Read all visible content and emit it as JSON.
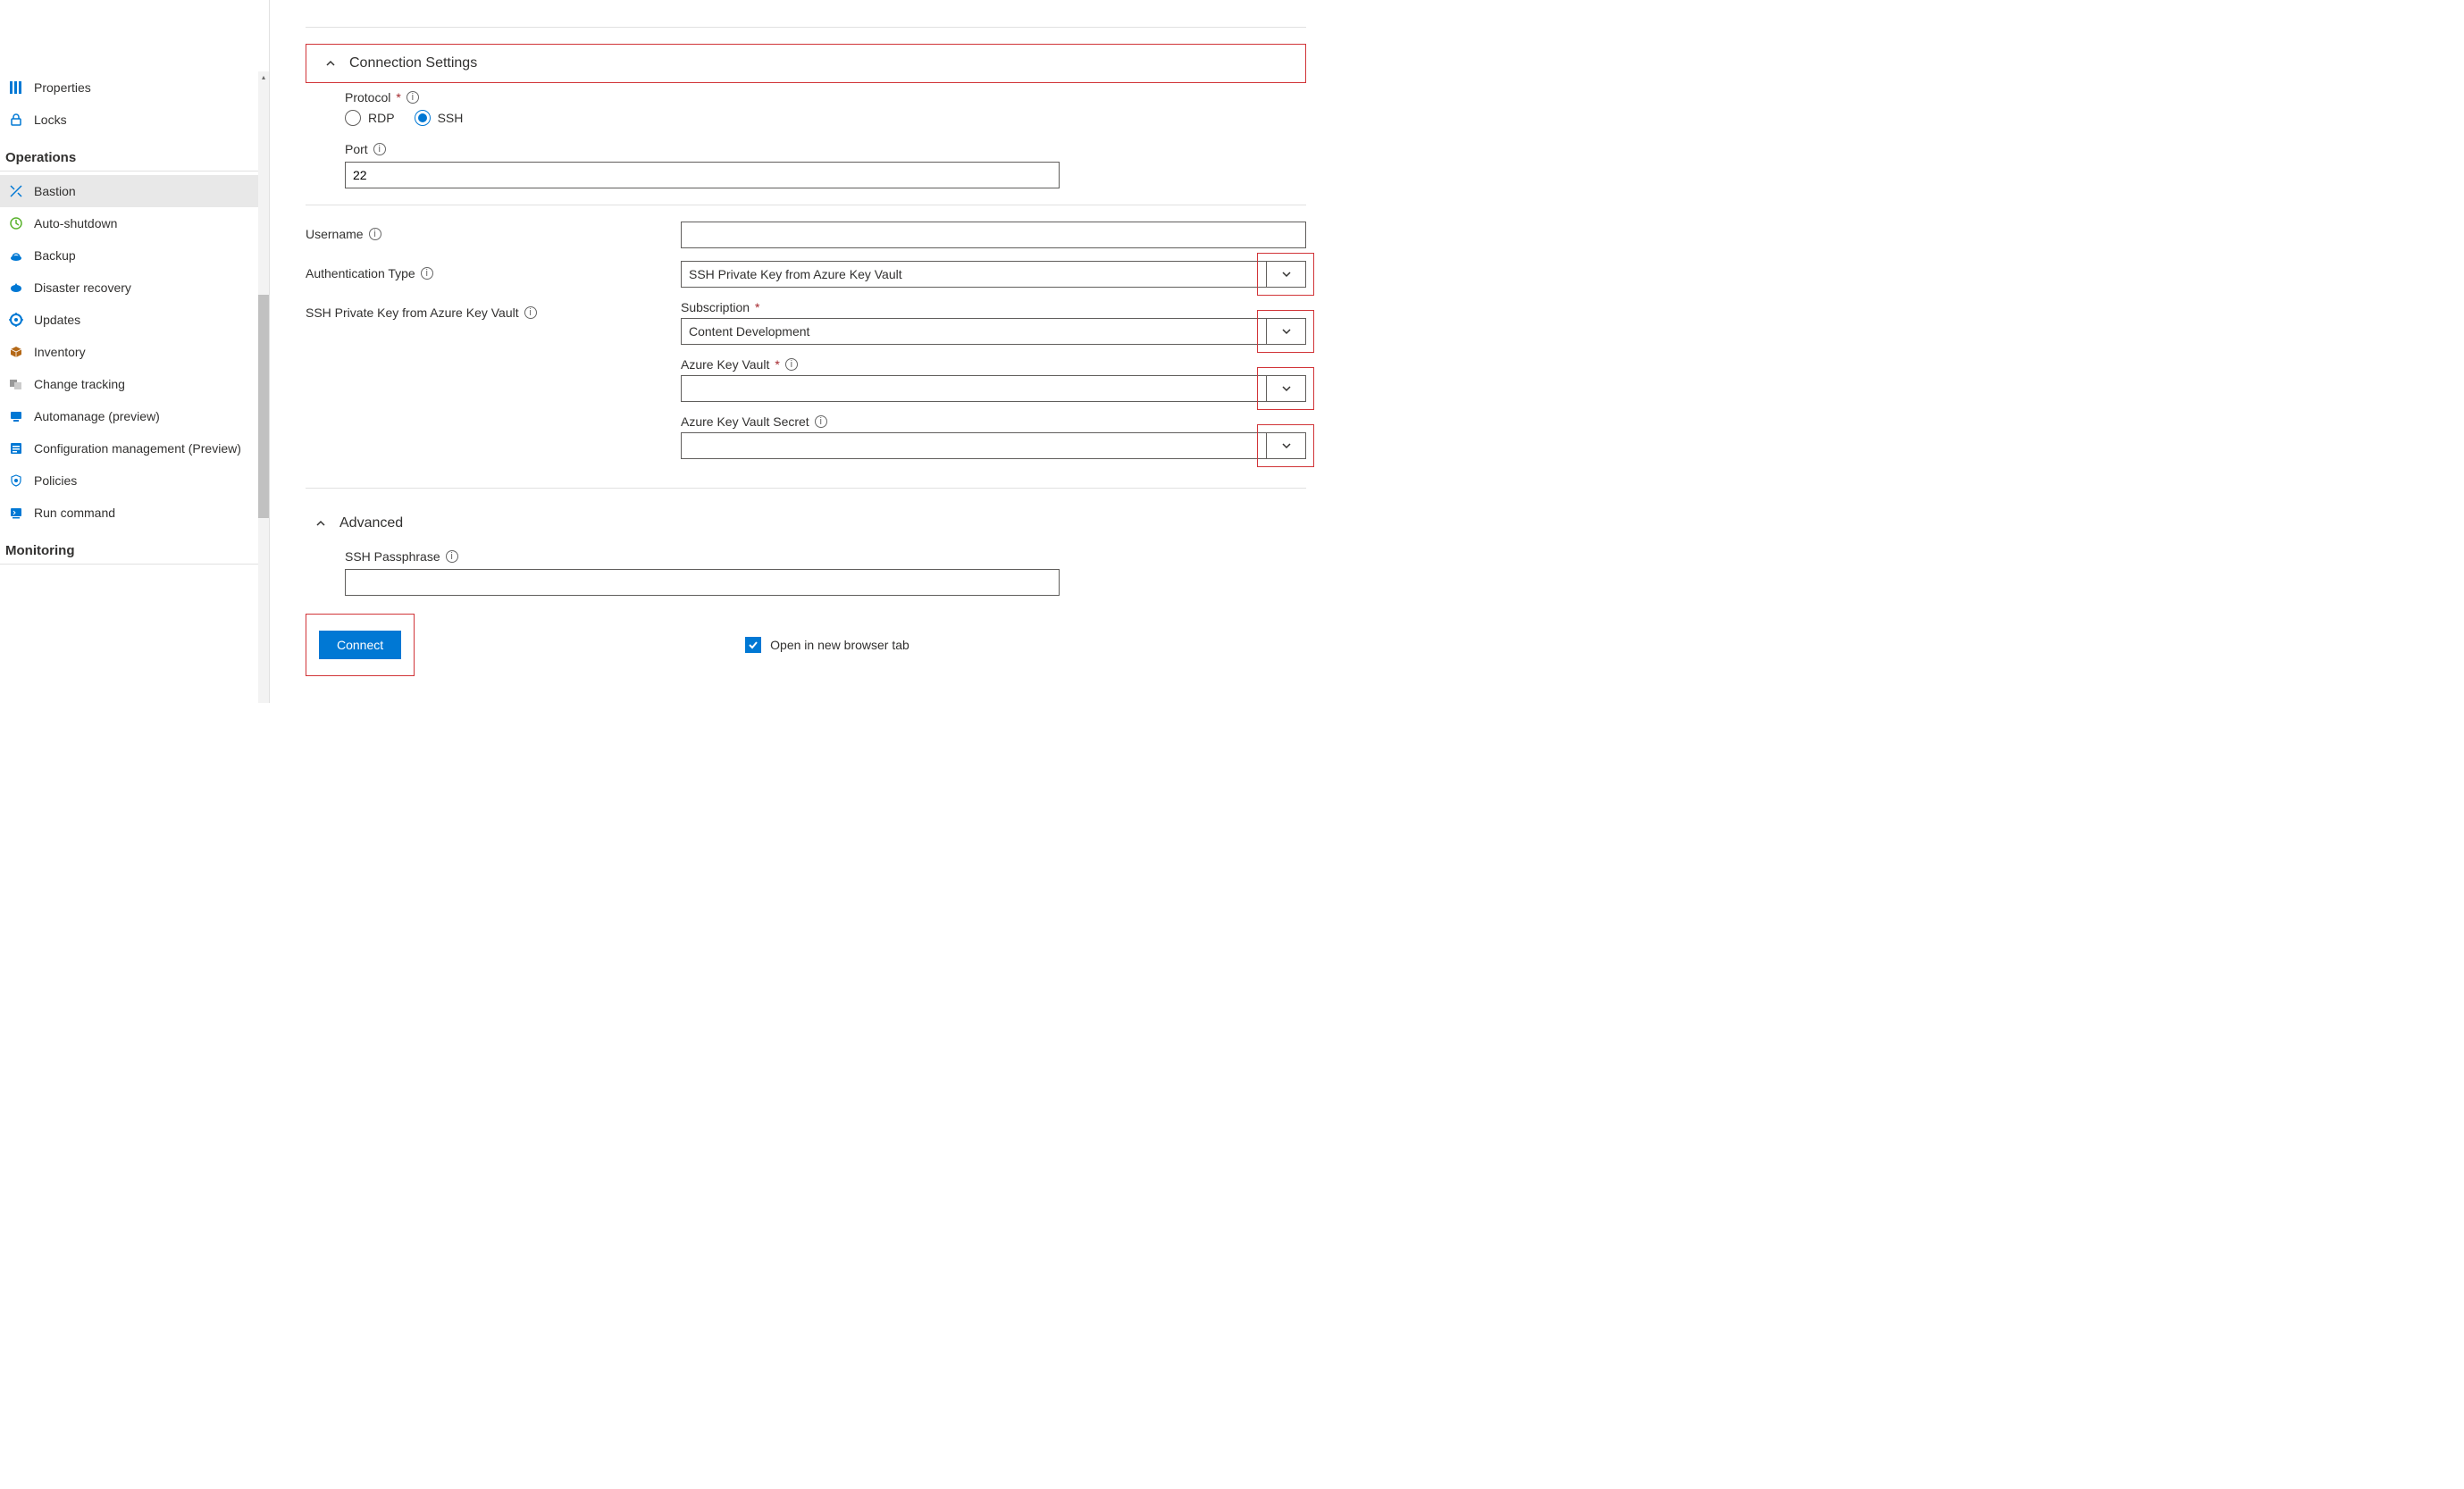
{
  "sidebar": {
    "items_top": [
      {
        "label": "Properties",
        "icon": "properties-icon",
        "color": "#0078d4"
      },
      {
        "label": "Locks",
        "icon": "lock-icon",
        "color": "#0078d4"
      }
    ],
    "section1_title": "Operations",
    "section1_items": [
      {
        "label": "Bastion",
        "icon": "bastion-icon",
        "color": "#0078d4",
        "selected": true
      },
      {
        "label": "Auto-shutdown",
        "icon": "clock-icon",
        "color": "#5BB32E"
      },
      {
        "label": "Backup",
        "icon": "backup-icon",
        "color": "#0078d4"
      },
      {
        "label": "Disaster recovery",
        "icon": "disaster-icon",
        "color": "#0078d4"
      },
      {
        "label": "Updates",
        "icon": "updates-icon",
        "color": "#0078d4"
      },
      {
        "label": "Inventory",
        "icon": "inventory-icon",
        "color": "#b46817"
      },
      {
        "label": "Change tracking",
        "icon": "change-icon",
        "color": "#666"
      },
      {
        "label": "Automanage (preview)",
        "icon": "automanage-icon",
        "color": "#0078d4"
      },
      {
        "label": "Configuration management (Preview)",
        "icon": "config-icon",
        "color": "#0078d4"
      },
      {
        "label": "Policies",
        "icon": "policies-icon",
        "color": "#0078d4"
      },
      {
        "label": "Run command",
        "icon": "run-icon",
        "color": "#0078d4"
      }
    ],
    "section2_title": "Monitoring"
  },
  "main": {
    "section_connection": "Connection Settings",
    "protocol": {
      "label": "Protocol",
      "options": {
        "rdp": "RDP",
        "ssh": "SSH"
      },
      "selected": "ssh"
    },
    "port": {
      "label": "Port",
      "value": "22"
    },
    "username": {
      "label": "Username",
      "value": ""
    },
    "auth_type": {
      "label": "Authentication Type",
      "value": "SSH Private Key from Azure Key Vault"
    },
    "ssh_kv_label": "SSH Private Key from Azure Key Vault",
    "subscription": {
      "label": "Subscription",
      "value": "Content Development"
    },
    "akv": {
      "label": "Azure Key Vault",
      "value": ""
    },
    "akv_secret": {
      "label": "Azure Key Vault Secret",
      "value": ""
    },
    "section_advanced": "Advanced",
    "ssh_passphrase": {
      "label": "SSH Passphrase",
      "value": ""
    },
    "connect_btn": "Connect",
    "open_new_tab": "Open in new browser tab"
  }
}
